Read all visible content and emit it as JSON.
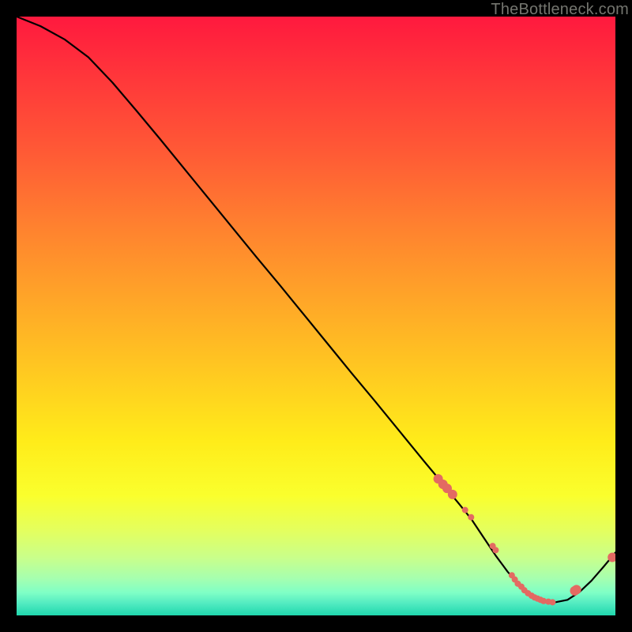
{
  "watermark": "TheBottleneck.com",
  "chart_data": {
    "type": "line",
    "title": "",
    "xlabel": "",
    "ylabel": "",
    "xlim": [
      0,
      100
    ],
    "ylim": [
      0,
      100
    ],
    "background": "heat-gradient",
    "series": [
      {
        "name": "curve",
        "x": [
          0,
          4,
          8,
          12,
          16,
          20,
          24,
          28,
          32,
          36,
          40,
          44,
          48,
          52,
          56,
          60,
          64,
          68,
          70,
          72,
          74,
          76,
          78,
          80,
          82,
          84,
          86,
          88,
          90,
          92,
          94,
          96,
          98,
          100
        ],
        "y": [
          100.0,
          98.4,
          96.2,
          93.2,
          89.0,
          84.3,
          79.5,
          74.6,
          69.7,
          64.8,
          59.9,
          55.1,
          50.2,
          45.3,
          40.4,
          35.6,
          30.7,
          25.8,
          23.4,
          20.9,
          18.5,
          16.0,
          13.0,
          10.0,
          7.3,
          5.0,
          3.4,
          2.4,
          2.2,
          2.6,
          3.9,
          5.8,
          8.1,
          10.5
        ]
      },
      {
        "name": "points",
        "type": "scatter",
        "x": [
          70.4,
          71.2,
          71.9,
          72.8,
          74.9,
          75.9,
          79.5,
          80.0,
          82.7,
          83.2,
          83.7,
          84.3,
          84.8,
          85.4,
          86.0,
          86.5,
          87.0,
          87.5,
          88.0,
          88.8,
          89.5,
          93.2,
          93.5,
          99.5
        ],
        "y": [
          22.8,
          21.9,
          21.2,
          20.2,
          17.6,
          16.4,
          11.6,
          10.9,
          6.7,
          6.0,
          5.3,
          4.8,
          4.2,
          3.7,
          3.3,
          3.0,
          2.8,
          2.6,
          2.4,
          2.3,
          2.2,
          4.1,
          4.3,
          9.7
        ],
        "color": "#e36a62",
        "radius_small": 4,
        "radius_large": 6
      }
    ],
    "gradient_stops": [
      {
        "offset": 0.0,
        "color": "#ff193e"
      },
      {
        "offset": 0.11,
        "color": "#ff393a"
      },
      {
        "offset": 0.23,
        "color": "#ff5b35"
      },
      {
        "offset": 0.35,
        "color": "#ff812f"
      },
      {
        "offset": 0.47,
        "color": "#ffa528"
      },
      {
        "offset": 0.59,
        "color": "#ffc821"
      },
      {
        "offset": 0.71,
        "color": "#ffec1a"
      },
      {
        "offset": 0.8,
        "color": "#faff2d"
      },
      {
        "offset": 0.86,
        "color": "#e3ff60"
      },
      {
        "offset": 0.905,
        "color": "#c8ff8c"
      },
      {
        "offset": 0.938,
        "color": "#a6ffaf"
      },
      {
        "offset": 0.962,
        "color": "#7fffc6"
      },
      {
        "offset": 0.98,
        "color": "#52ebc1"
      },
      {
        "offset": 1.0,
        "color": "#1fd7ad"
      }
    ]
  }
}
